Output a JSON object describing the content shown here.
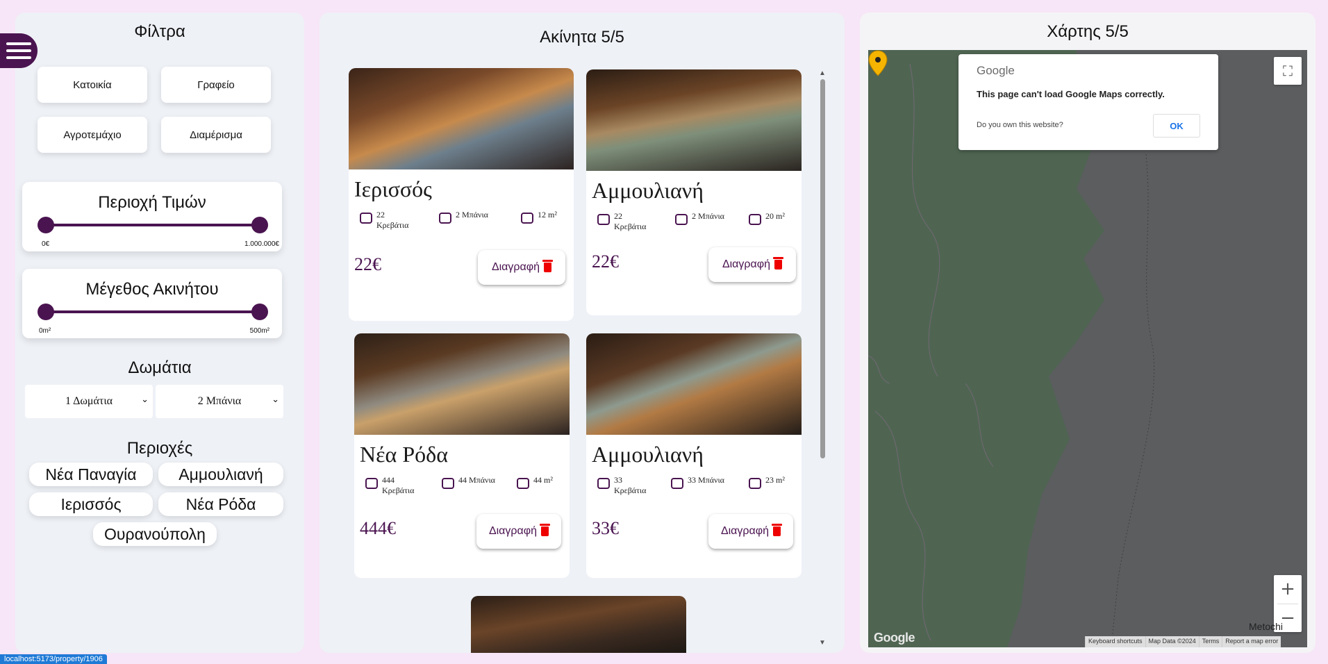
{
  "filters": {
    "title": "Φίλτρα",
    "types": [
      "Κατοικία",
      "Γραφείο",
      "Αγροτεμάχιο",
      "Διαμέρισμα"
    ],
    "price": {
      "title": "Περιοχή Τιμών",
      "min": "0€",
      "max": "1.000.000€",
      "low": 0,
      "high": 1
    },
    "size": {
      "title": "Μέγεθος Ακινήτου",
      "min": "0m²",
      "max": "500m²",
      "low": 0,
      "high": 1
    },
    "rooms_title": "Δωμάτια",
    "rooms_select": "1 Δωμάτια",
    "baths_select": "2 Μπάνια",
    "areas_title": "Περιοχές",
    "areas": [
      "Νέα Παναγία",
      "Αμμουλιανή",
      "Ιερισσός",
      "Νέα Ρόδα",
      "Ουρανούπολη"
    ]
  },
  "properties": {
    "title": "Ακίνητα 5/5",
    "delete_label": "Διαγραφή",
    "cards": [
      {
        "name": "Ιερισσός",
        "beds": "22",
        "beds_label": "Κρεβάτια",
        "baths": "2 Μπάνια",
        "area": "12 m²",
        "price": "22€"
      },
      {
        "name": "Αμμουλιανή",
        "beds": "22",
        "beds_label": "Κρεβάτια",
        "baths": "2 Μπάνια",
        "area": "20 m²",
        "price": "22€"
      },
      {
        "name": "Νέα Ρόδα",
        "beds": "444",
        "beds_label": "Κρεβάτια",
        "baths": "44 Μπάνια",
        "area": "44 m²",
        "price": "444€"
      },
      {
        "name": "Αμμουλιανή",
        "beds": "33",
        "beds_label": "Κρεβάτια",
        "baths": "33 Μπάνια",
        "area": "23 m²",
        "price": "33€"
      }
    ]
  },
  "map": {
    "title": "Χάρτης 5/5",
    "dialog": {
      "brand": "Google",
      "message": "This page can't load Google Maps correctly.",
      "question": "Do you own this website?",
      "ok": "OK"
    },
    "logo": "Google",
    "footer": [
      "Keyboard shortcuts",
      "Map Data ©2024",
      "Terms",
      "Report a map error"
    ],
    "place_label": "Metochi",
    "zoom_in": "+",
    "zoom_out": "−"
  },
  "status_url": "localhost:5173/property/1906",
  "colors": {
    "accent": "#4a1450",
    "page_bg": "#f7e6f7",
    "panel_bg": "#eef1f6",
    "forest": "#4f6552",
    "sea": "#5b5d5f",
    "pin": "#f4b400",
    "delete_icon": "#e00000"
  }
}
